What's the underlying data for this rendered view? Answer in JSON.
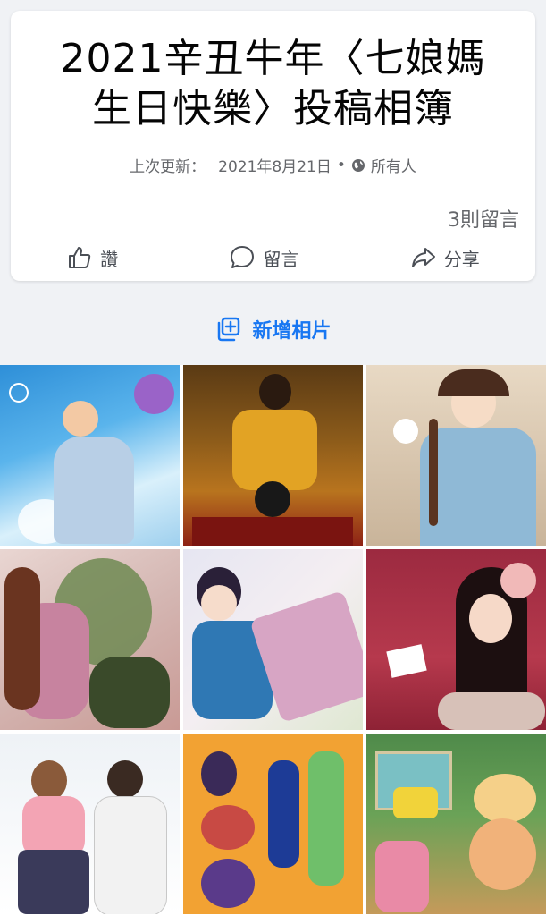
{
  "album": {
    "title_line1": "2021辛丑牛年〈七娘媽",
    "title_line2": "生日快樂〉投稿相簿",
    "updated_label": "上次更新：",
    "updated_date": "2021年8月21日",
    "separator": "•",
    "audience": "所有人",
    "comment_count": "3則留言"
  },
  "actions": {
    "like": "讚",
    "comment": "留言",
    "share": "分享"
  },
  "add_photo_label": "新增相片",
  "colors": {
    "accent": "#1877f2",
    "text_primary": "#050505",
    "text_secondary": "#65676b"
  },
  "photos": [
    {
      "alt": "girl in blue dress with bubbles and flowers"
    },
    {
      "alt": "boy in yellow shirt with black cat"
    },
    {
      "alt": "girl with braid holding lily"
    },
    {
      "alt": "two figures in green and pink"
    },
    {
      "alt": "girl in blue cheongsam with pink skirt"
    },
    {
      "alt": "girl in red with love letter"
    },
    {
      "alt": "medical workers vaccinating"
    },
    {
      "alt": "group of women in traditional clothes"
    },
    {
      "alt": "animal crossing character with sewing machine"
    }
  ]
}
